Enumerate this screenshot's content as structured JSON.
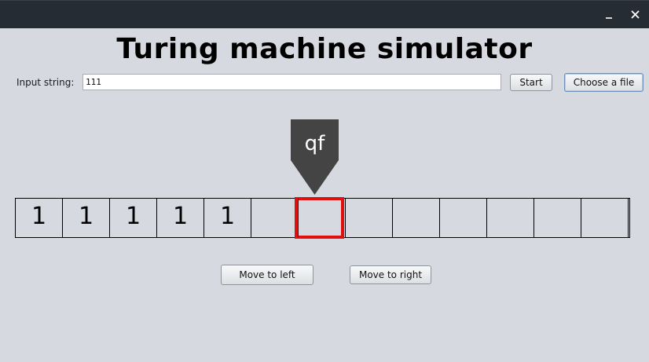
{
  "window": {
    "title": "Turing machine simulator"
  },
  "input": {
    "label": "Input string:",
    "value": "111"
  },
  "buttons": {
    "start": "Start",
    "choose_file": "Choose a file",
    "move_left": "Move to left",
    "move_right": "Move to right"
  },
  "head": {
    "state": "qf",
    "position_cell_index": 6
  },
  "tape": {
    "cells": [
      "1",
      "1",
      "1",
      "1",
      "1",
      "",
      "",
      "",
      "",
      "",
      "",
      "",
      "",
      ""
    ]
  },
  "colors": {
    "titlebar": "#262c33",
    "background": "#d6d9df",
    "head": "#444444",
    "active_cell_border": "#e01010"
  },
  "icons": {
    "minimize": "minimize-icon",
    "close": "close-icon"
  }
}
